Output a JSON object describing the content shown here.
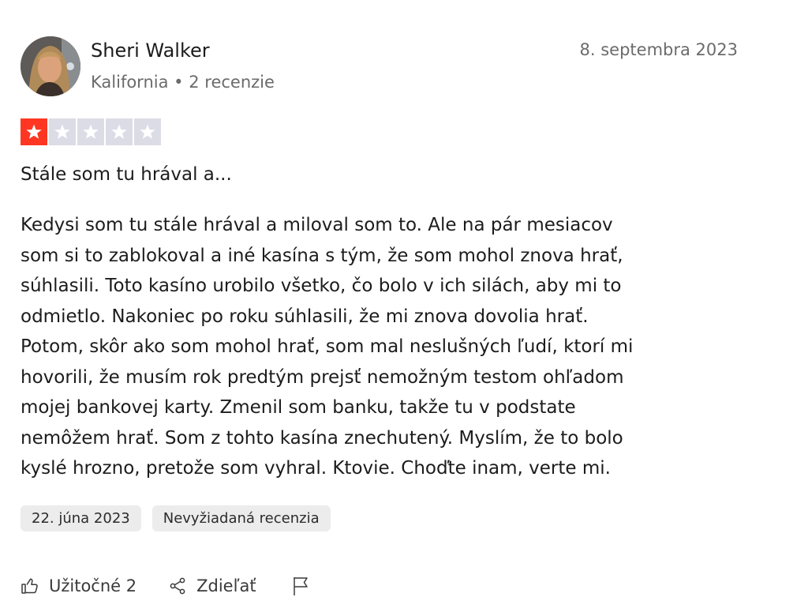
{
  "review": {
    "author": {
      "name": "Sheri Walker",
      "location": "Kalifornia",
      "separator": "•",
      "reviews_count": "2 recenzie"
    },
    "date_posted": "8. septembra 2023",
    "rating": {
      "value": 1,
      "max": 5
    },
    "title": "Stále som tu hrával a...",
    "body_lines": [
      "Kedysi som tu stále hrával a miloval som to. Ale na pár mesiacov",
      "som si to zablokoval a iné kasína s tým, že som mohol znova hrať,",
      "súhlasili. Toto kasíno urobilo všetko, čo bolo v ich silách, aby mi to",
      "odmietlo. Nakoniec po roku súhlasili, že mi znova dovolia hrať.",
      "Potom, skôr ako som mohol hrať, som mal neslušných ľudí, ktorí mi",
      "hovorili, že musím rok predtým prejsť nemožným testom ohľadom",
      "mojej bankovej karty. Zmenil som banku, takže tu v podstate",
      "nemôžem hrať. Som z tohto kasína znechutený. Myslím, že to bolo",
      "kyslé hrozno, pretože som vyhral. Ktovie. Choďte inam, verte mi."
    ],
    "tags": {
      "experience_date": "22. júna 2023",
      "unprompted": "Nevyžiadaná recenzia"
    },
    "actions": {
      "helpful_label": "Užitočné 2",
      "share_label": "Zdieľať"
    }
  },
  "colors": {
    "star_active": "#ff3722",
    "star_inactive": "#dcdce6",
    "tag_bg": "#ececec",
    "muted_text": "#6b6b6b"
  },
  "icons": {
    "helpful": "thumbs-up-icon",
    "share": "share-icon",
    "report": "flag-icon"
  }
}
